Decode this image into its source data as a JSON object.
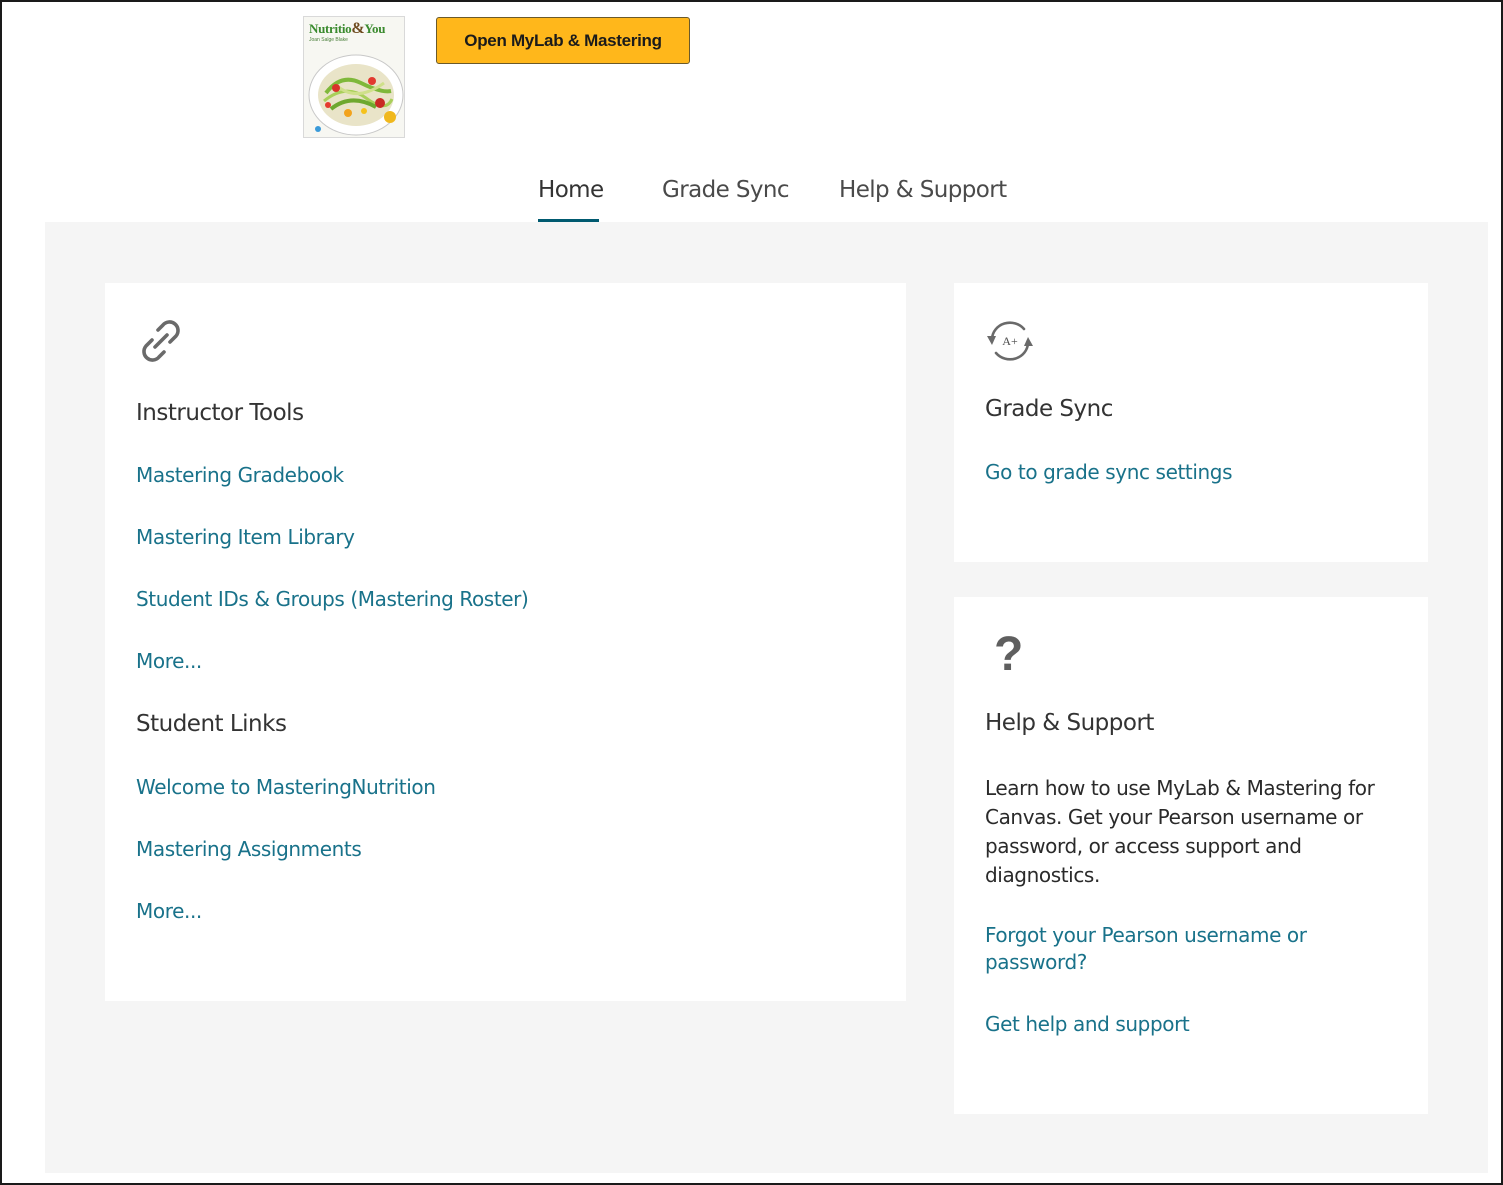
{
  "header": {
    "book_cover": {
      "title_part1": "Nutritio",
      "title_amp": "&",
      "title_part2": "You",
      "author": "Joan Salge Blake"
    },
    "open_button_label": "Open MyLab & Mastering"
  },
  "tabs": [
    {
      "label": "Home",
      "active": true
    },
    {
      "label": "Grade Sync",
      "active": false
    },
    {
      "label": "Help & Support",
      "active": false
    }
  ],
  "tools_card": {
    "icon": "link-icon",
    "instructor_heading": "Instructor Tools",
    "instructor_links": [
      "Mastering Gradebook",
      "Mastering Item Library",
      "Student IDs & Groups (Mastering Roster)",
      "More..."
    ],
    "student_heading": "Student Links",
    "student_links": [
      "Welcome to MasteringNutrition",
      "Mastering Assignments",
      "More..."
    ]
  },
  "sync_card": {
    "icon": "grade-sync-icon",
    "icon_text": "A+",
    "heading": "Grade Sync",
    "link": "Go to grade sync settings"
  },
  "help_card": {
    "icon": "question-mark-icon",
    "icon_text": "?",
    "heading": "Help & Support",
    "description": "Learn how to use MyLab & Mastering for Canvas. Get your Pearson username or password, or access support and diagnostics.",
    "links": [
      "Forgot your Pearson username or password?",
      "Get help and support"
    ]
  },
  "colors": {
    "accent_button": "#ffb71b",
    "link": "#19728a",
    "tab_underline": "#005a70",
    "background_panel": "#f5f5f5"
  }
}
